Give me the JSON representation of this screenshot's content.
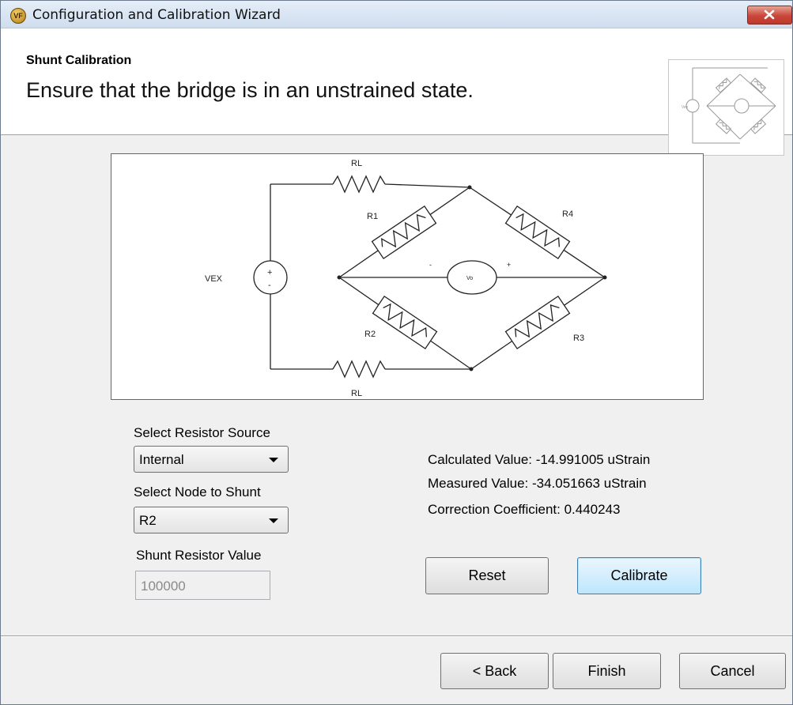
{
  "window": {
    "title": "Configuration and Calibration Wizard",
    "icon_text": "VF"
  },
  "header": {
    "title": "Shunt Calibration",
    "subtitle": "Ensure that the bridge is in an unstrained state."
  },
  "circuit": {
    "labels": {
      "rl_top": "RL",
      "rl_bottom": "RL",
      "r1": "R1",
      "r2": "R2",
      "r3": "R3",
      "r4": "R4",
      "vex": "VEX",
      "vo": "Vo",
      "plus": "+",
      "minus": "-"
    }
  },
  "form": {
    "resistor_source_label": "Select Resistor Source",
    "resistor_source_value": "Internal",
    "node_label": "Select Node to Shunt",
    "node_value": "R2",
    "shunt_value_label": "Shunt Resistor Value",
    "shunt_value": "100000"
  },
  "results": {
    "calculated": "Calculated Value: -14.991005 uStrain",
    "measured": "Measured Value: -34.051663 uStrain",
    "coefficient": "Correction Coefficient: 0.440243"
  },
  "buttons": {
    "reset": "Reset",
    "calibrate": "Calibrate",
    "back": "< Back",
    "finish": "Finish",
    "cancel": "Cancel"
  },
  "colors": {
    "close_button": "#c9463a",
    "focus_button": "#bee6fd",
    "window_bg": "#f0f0f0"
  }
}
